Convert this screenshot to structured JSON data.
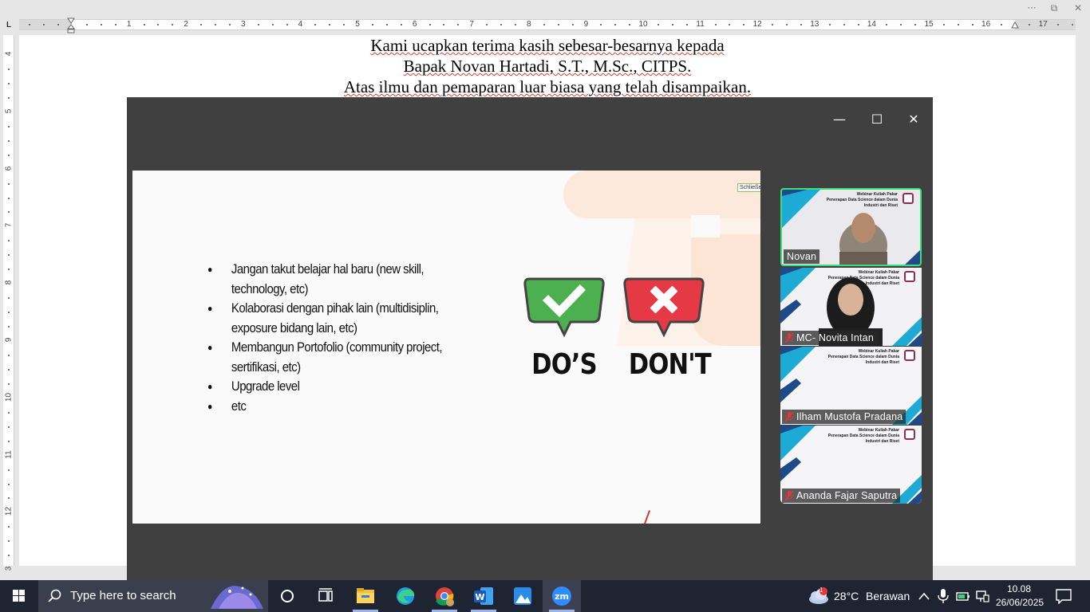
{
  "word": {
    "title_controls": {
      "more": "···",
      "restore": "⧉",
      "close": "✕"
    },
    "ruler": {
      "tab_selector": "L",
      "h_numbers": [
        "1",
        "2",
        "3",
        "4",
        "5",
        "6",
        "7",
        "8",
        "9",
        "10",
        "11",
        "12",
        "13",
        "14",
        "15",
        "16",
        "17"
      ],
      "v_numbers": [
        "4",
        "5",
        "6",
        "7",
        "8",
        "9",
        "10",
        "11",
        "12",
        "3"
      ]
    },
    "document": {
      "lines": [
        "Kami ucapkan terima kasih sebesar-besarnya kepada",
        "Bapak Novan Hartadi, S.T., M.Sc., CITPS.",
        "Atas ilmu dan pemaparan luar biasa yang telah disampaikan."
      ]
    }
  },
  "zoom": {
    "window_controls": {
      "minimize": "—",
      "maximize": "☐",
      "close": "✕"
    },
    "slide": {
      "close_tag": "Schließen",
      "bullets": [
        "Jangan takut belajar hal baru (new skill, technology, etc)",
        "Kolaborasi dengan pihak lain (multidisiplin, exposure bidang lain, etc)",
        "Membangun Portofolio (community project, sertifikasi, etc)",
        "Upgrade level",
        "etc"
      ],
      "dos_label": "DO’S",
      "dont_label": "DON'T",
      "colors": {
        "do_green": "#4caf50",
        "dont_red": "#e53935"
      }
    },
    "participants": [
      {
        "name": "Novan",
        "muted": false,
        "active_speaker": true
      },
      {
        "name": "MC- Novita Intan",
        "muted": true,
        "active_speaker": false
      },
      {
        "name": "Ilham Mustofa Pradana",
        "muted": true,
        "active_speaker": false
      },
      {
        "name": "Ananda Fajar Saputra",
        "muted": true,
        "active_speaker": false
      }
    ],
    "tile_banner": {
      "line1": "Webinar Kuliah Pakar",
      "line2": "Penerapan Data Science dalam Dunia",
      "line3": "Industri dan Riset"
    }
  },
  "taskbar": {
    "search_placeholder": "Type here to search",
    "weather": {
      "temp": "28°C",
      "condition": "Berawan",
      "badge": "1"
    },
    "clock": {
      "time": "10.08",
      "date": "26/06/2025"
    },
    "apps": [
      "cortana-icon",
      "task-view-icon",
      "file-explorer-icon",
      "edge-icon",
      "chrome-icon",
      "word-icon",
      "photos-icon",
      "zoom-icon"
    ]
  }
}
